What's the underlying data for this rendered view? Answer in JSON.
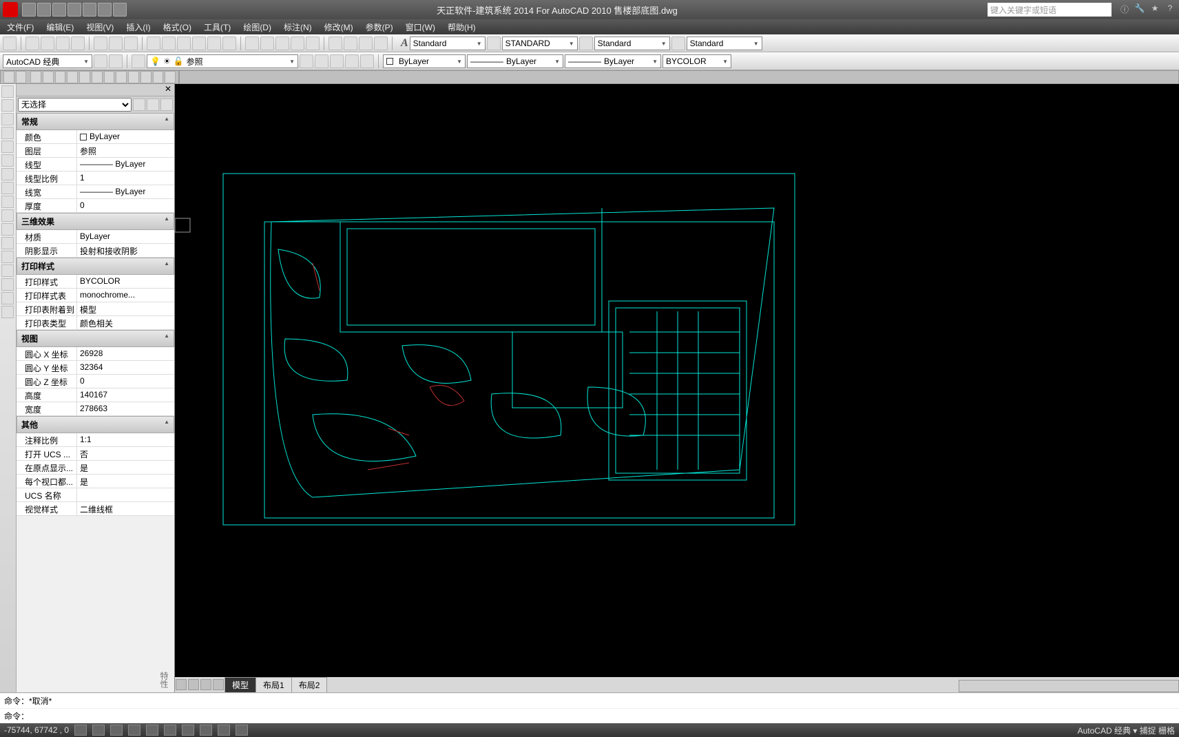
{
  "title": "天正软件-建筑系统 2014  For AutoCAD 2010      售楼部底图.dwg",
  "search_placeholder": "键入关键字或短语",
  "menubar": [
    "文件(F)",
    "编辑(E)",
    "视图(V)",
    "插入(I)",
    "格式(O)",
    "工具(T)",
    "绘图(D)",
    "标注(N)",
    "修改(M)",
    "参数(P)",
    "窗口(W)",
    "帮助(H)"
  ],
  "toolbar1": {
    "style_a_label": "A",
    "style_a": "Standard",
    "style_b": "STANDARD",
    "style_c": "Standard",
    "style_d": "Standard"
  },
  "toolbar2": {
    "workspace": "AutoCAD 经典",
    "xref_label": "参照",
    "layer": "ByLayer",
    "linetype": "ByLayer",
    "color": "BYCOLOR"
  },
  "props": {
    "selector": "无选择",
    "sections": {
      "general": {
        "title": "常规",
        "rows": [
          {
            "k": "颜色",
            "v": "ByLayer",
            "swatch": "#fff"
          },
          {
            "k": "图层",
            "v": "参照"
          },
          {
            "k": "线型",
            "v": "———— ByLayer"
          },
          {
            "k": "线型比例",
            "v": "1"
          },
          {
            "k": "线宽",
            "v": "———— ByLayer"
          },
          {
            "k": "厚度",
            "v": "0"
          }
        ]
      },
      "three_d": {
        "title": "三维效果",
        "rows": [
          {
            "k": "材质",
            "v": "ByLayer"
          },
          {
            "k": "阴影显示",
            "v": "投射和接收阴影"
          }
        ]
      },
      "plot": {
        "title": "打印样式",
        "rows": [
          {
            "k": "打印样式",
            "v": "BYCOLOR"
          },
          {
            "k": "打印样式表",
            "v": "monochrome..."
          },
          {
            "k": "打印表附着到",
            "v": "模型"
          },
          {
            "k": "打印表类型",
            "v": "颜色相关"
          }
        ]
      },
      "view": {
        "title": "视图",
        "rows": [
          {
            "k": "圆心 X 坐标",
            "v": "26928"
          },
          {
            "k": "圆心 Y 坐标",
            "v": "32364"
          },
          {
            "k": "圆心 Z 坐标",
            "v": "0"
          },
          {
            "k": "高度",
            "v": "140167"
          },
          {
            "k": "宽度",
            "v": "278663"
          }
        ]
      },
      "other": {
        "title": "其他",
        "rows": [
          {
            "k": "注释比例",
            "v": "1:1"
          },
          {
            "k": "打开 UCS ...",
            "v": "否"
          },
          {
            "k": "在原点显示...",
            "v": "是"
          },
          {
            "k": "每个视口都...",
            "v": "是"
          },
          {
            "k": "UCS 名称",
            "v": ""
          },
          {
            "k": "视觉样式",
            "v": "二维线框"
          }
        ]
      }
    }
  },
  "tabs": {
    "active": "模型",
    "others": [
      "布局1",
      "布局2"
    ]
  },
  "cmd": {
    "line1": "命令：*取消*",
    "line2": "命令："
  },
  "status": {
    "coords": "-75744, 67742 , 0",
    "right": "AutoCAD 经典  ▾  捕捉 栅格"
  },
  "side_label": "特性"
}
